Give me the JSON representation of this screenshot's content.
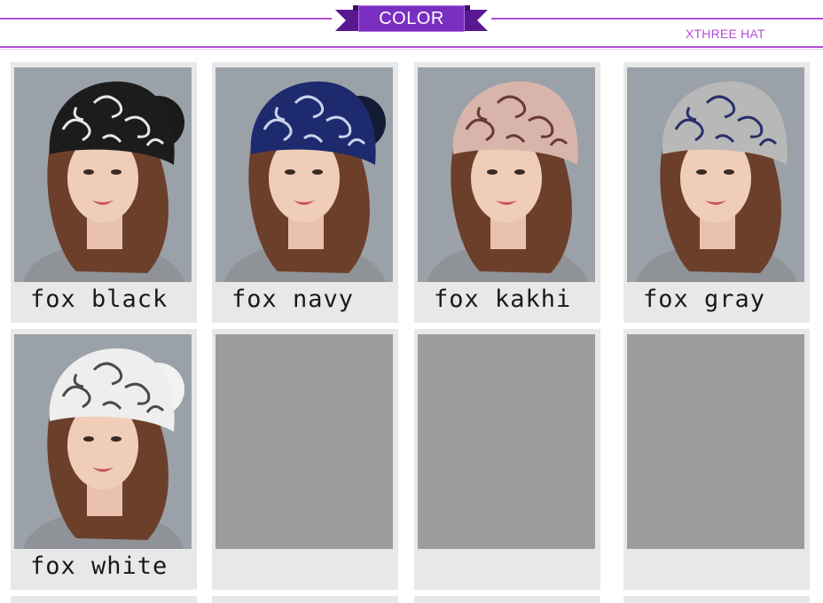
{
  "header": {
    "title": "COLOR",
    "brand": "XTHREE HAT"
  },
  "colors": {
    "accent": "#b04fd6",
    "ribbon": "#7a2fc0",
    "card_bg": "#e8e8e8",
    "placeholder": "#9c9c9c"
  },
  "products": [
    {
      "label": "fox black",
      "hat_color": "#1c1c1c",
      "pattern_color": "#e6e6e6",
      "pompom": "#1a1a1a"
    },
    {
      "label": "fox navy",
      "hat_color": "#1e2a6e",
      "pattern_color": "#c9d3ec",
      "pompom": "#131a33"
    },
    {
      "label": "fox kakhi",
      "hat_color": "#d9b4aa",
      "pattern_color": "#6a3a35",
      "pompom": null
    },
    {
      "label": "fox gray",
      "hat_color": "#b8b8b8",
      "pattern_color": "#2a2f6a",
      "pompom": null
    },
    {
      "label": "fox white",
      "hat_color": "#eeeeee",
      "pattern_color": "#4a4a4a",
      "pompom": "#f2f2f2"
    },
    {
      "label": "",
      "hat_color": null
    },
    {
      "label": "",
      "hat_color": null
    },
    {
      "label": "",
      "hat_color": null
    }
  ]
}
